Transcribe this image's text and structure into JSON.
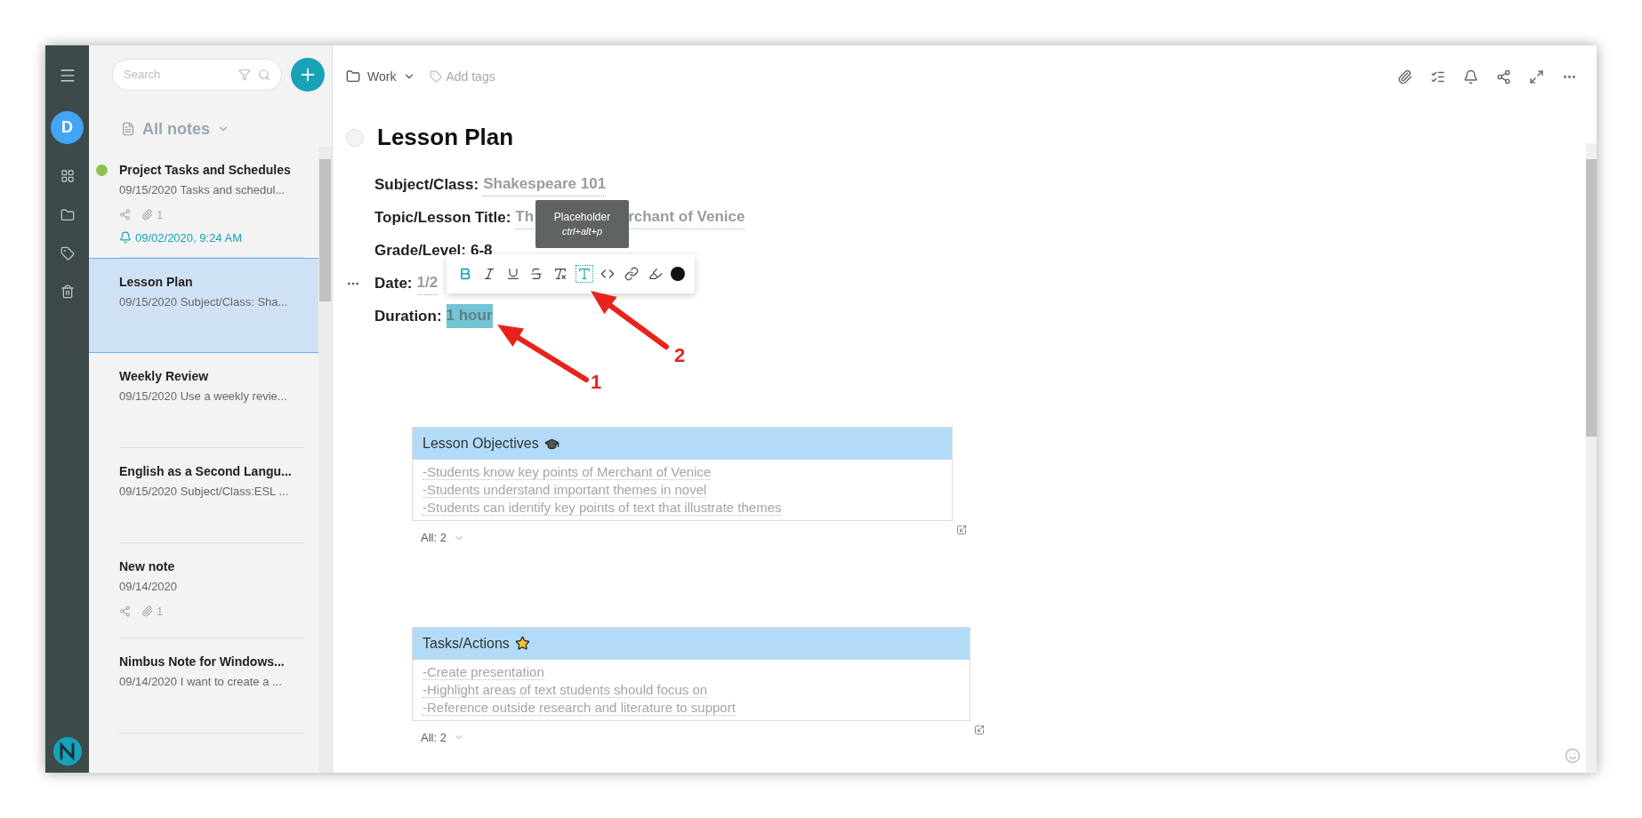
{
  "rail": {
    "avatar": "D"
  },
  "search": {
    "placeholder": "Search"
  },
  "notes_header": {
    "label": "All notes"
  },
  "notes": [
    {
      "title": "Project Tasks and Schedules",
      "preview": "09/15/2020 Tasks and schedul...",
      "selected": false,
      "color": "#8bc34a",
      "shared": true,
      "attachments": "1",
      "reminder": "09/02/2020, 9:24 AM"
    },
    {
      "title": "Lesson Plan",
      "preview": "09/15/2020 Subject/Class: Sha...",
      "selected": true
    },
    {
      "title": "Weekly Review",
      "preview": "09/15/2020 Use a weekly revie...",
      "selected": false
    },
    {
      "title": "English as a Second Langu...",
      "preview": "09/15/2020 Subject/Class:ESL ...",
      "selected": false
    },
    {
      "title": "New note",
      "preview": "09/14/2020",
      "selected": false,
      "shared": true,
      "attachments": "1"
    },
    {
      "title": "Nimbus Note for Windows...",
      "preview": "09/14/2020 I want to create a ...",
      "selected": false
    }
  ],
  "editor": {
    "folder": "Work",
    "tags_placeholder": "Add tags",
    "title": "Lesson Plan",
    "fields": [
      {
        "label": "Subject/Class:",
        "value": "Shakespeare 101",
        "kind": "placeholder",
        "highlighted": false
      },
      {
        "label": "Topic/Lesson Title:",
        "value": "Th",
        "value_after": "rchant of Venice",
        "kind": "placeholder",
        "highlighted": false
      },
      {
        "label": "Grade/Level:",
        "value": "6-8",
        "kind": "text",
        "highlighted": false
      },
      {
        "label": "Date:",
        "value": "1/2",
        "kind": "placeholder",
        "highlighted": false
      },
      {
        "label": "Duration:",
        "value": "1 hour",
        "kind": "placeholder",
        "highlighted": true
      }
    ],
    "tables": [
      {
        "title": "Lesson Objectives",
        "rows": [
          "-Students know key points of Merchant of Venice",
          "-Students understand important themes in novel",
          "-Students can identify key points of text that illustrate themes"
        ],
        "footer": "All: 2"
      },
      {
        "title": "Tasks/Actions",
        "rows": [
          "-Create presentation",
          "-Highlight areas of text students should focus on",
          "-Reference outside research and literature to support"
        ],
        "footer": "All: 2"
      }
    ]
  },
  "format_toolbar": {
    "buttons": [
      {
        "kind": "bold",
        "active": true
      },
      {
        "kind": "italic",
        "active": false
      },
      {
        "kind": "underline",
        "active": false
      },
      {
        "kind": "strike",
        "active": false
      },
      {
        "kind": "clear",
        "active": false
      },
      {
        "kind": "placeholder",
        "active": true
      },
      {
        "kind": "code",
        "active": false
      },
      {
        "kind": "link",
        "active": false
      },
      {
        "kind": "highlight",
        "active": false
      },
      {
        "kind": "color",
        "active": false
      }
    ]
  },
  "tooltip": {
    "title": "Placeholder",
    "shortcut": "ctrl+alt+p"
  },
  "annotations": [
    {
      "label": "1"
    },
    {
      "label": "2"
    }
  ]
}
